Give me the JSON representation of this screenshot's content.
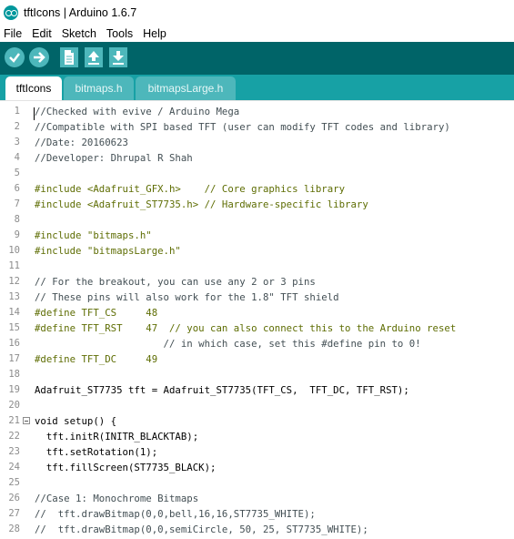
{
  "window": {
    "title": "tftIcons | Arduino 1.6.7"
  },
  "menu": [
    "File",
    "Edit",
    "Sketch",
    "Tools",
    "Help"
  ],
  "toolbar": {
    "buttons": [
      "verify-icon",
      "upload-icon",
      "new-icon",
      "open-icon",
      "save-icon"
    ],
    "color": "#006468",
    "button_color": "#4db7bb"
  },
  "tabs": [
    {
      "label": "tftIcons",
      "active": true
    },
    {
      "label": "bitmaps.h",
      "active": false
    },
    {
      "label": "bitmapsLarge.h",
      "active": false
    }
  ],
  "editor": {
    "lines": [
      {
        "n": "1",
        "text": "//Checked with evive / Arduino Mega"
      },
      {
        "n": "2",
        "text": "//Compatible with SPI based TFT (user can modify TFT codes and library)"
      },
      {
        "n": "3",
        "text": "//Date: 20160623"
      },
      {
        "n": "4",
        "text": "//Developer: Dhrupal R Shah"
      },
      {
        "n": "5",
        "text": ""
      },
      {
        "n": "6",
        "text": "#include <Adafruit_GFX.h>    // Core graphics library"
      },
      {
        "n": "7",
        "text": "#include <Adafruit_ST7735.h> // Hardware-specific library"
      },
      {
        "n": "8",
        "text": ""
      },
      {
        "n": "9",
        "text": "#include \"bitmaps.h\""
      },
      {
        "n": "10",
        "text": "#include \"bitmapsLarge.h\""
      },
      {
        "n": "11",
        "text": ""
      },
      {
        "n": "12",
        "text": "// For the breakout, you can use any 2 or 3 pins"
      },
      {
        "n": "13",
        "text": "// These pins will also work for the 1.8\" TFT shield"
      },
      {
        "n": "14",
        "text": "#define TFT_CS     48"
      },
      {
        "n": "15",
        "text": "#define TFT_RST    47  // you can also connect this to the Arduino reset"
      },
      {
        "n": "16",
        "text": "                      // in which case, set this #define pin to 0!"
      },
      {
        "n": "17",
        "text": "#define TFT_DC     49"
      },
      {
        "n": "18",
        "text": ""
      },
      {
        "n": "19",
        "text": "Adafruit_ST7735 tft = Adafruit_ST7735(TFT_CS,  TFT_DC, TFT_RST);"
      },
      {
        "n": "20",
        "text": ""
      },
      {
        "n": "21",
        "text": "void setup() {"
      },
      {
        "n": "22",
        "text": "  tft.initR(INITR_BLACKTAB);"
      },
      {
        "n": "23",
        "text": "  tft.setRotation(1);"
      },
      {
        "n": "24",
        "text": "  tft.fillScreen(ST7735_BLACK);"
      },
      {
        "n": "25",
        "text": ""
      },
      {
        "n": "26",
        "text": "//Case 1: Monochrome Bitmaps"
      },
      {
        "n": "27",
        "text": "//  tft.drawBitmap(0,0,bell,16,16,ST7735_WHITE);"
      },
      {
        "n": "28",
        "text": "//  tft.drawBitmap(0,0,semiCircle, 50, 25, ST7735_WHITE);"
      }
    ]
  }
}
